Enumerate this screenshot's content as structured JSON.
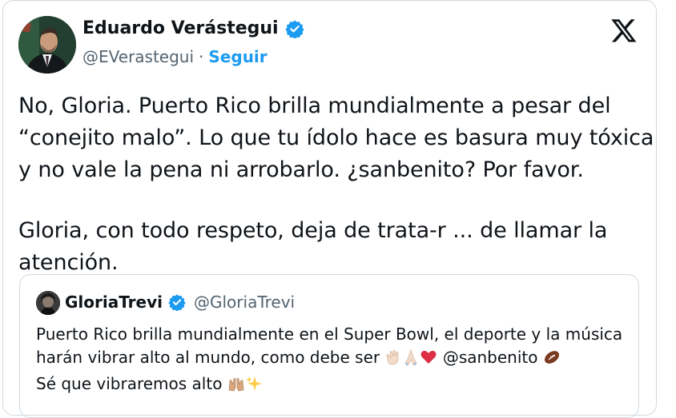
{
  "author": {
    "name": "Eduardo Verástegui",
    "handle": "@EVerastegui",
    "separator": "·",
    "follow_label": "Seguir"
  },
  "tweet": {
    "lines": [
      "No, Gloria. Puerto Rico brilla mundialmente a pesar del",
      "“conejito malo”. Lo que tu ídolo hace es basura muy tóxica",
      "y no vale la pena ni arrobarlo. ¿sanbenito? Por favor.",
      "Gloria, con todo respeto, deja de trata-r ... de llamar la",
      "atención."
    ]
  },
  "quoted": {
    "name": "GloriaTrevi",
    "handle": "@GloriaTrevi",
    "line1": "Puerto Rico brilla mundialmente en el Super Bowl, el deporte y la música",
    "line2_text": "harán vibrar alto al mundo, como debe ser ",
    "line2_mention": " @sanbenito ",
    "line3_text": "Sé que vibraremos alto "
  },
  "icons": {
    "verified": "verified-badge-icon",
    "x_logo": "x-logo-icon",
    "emojis": [
      "clapping-hands-icon",
      "folded-hands-icon",
      "red-heart-icon",
      "american-football-icon",
      "raising-hands-icon",
      "sparkles-icon"
    ]
  },
  "colors": {
    "accent": "#1d9bf0",
    "secondary_text": "#536471",
    "border": "#cfd9de",
    "text": "#0f1419"
  }
}
